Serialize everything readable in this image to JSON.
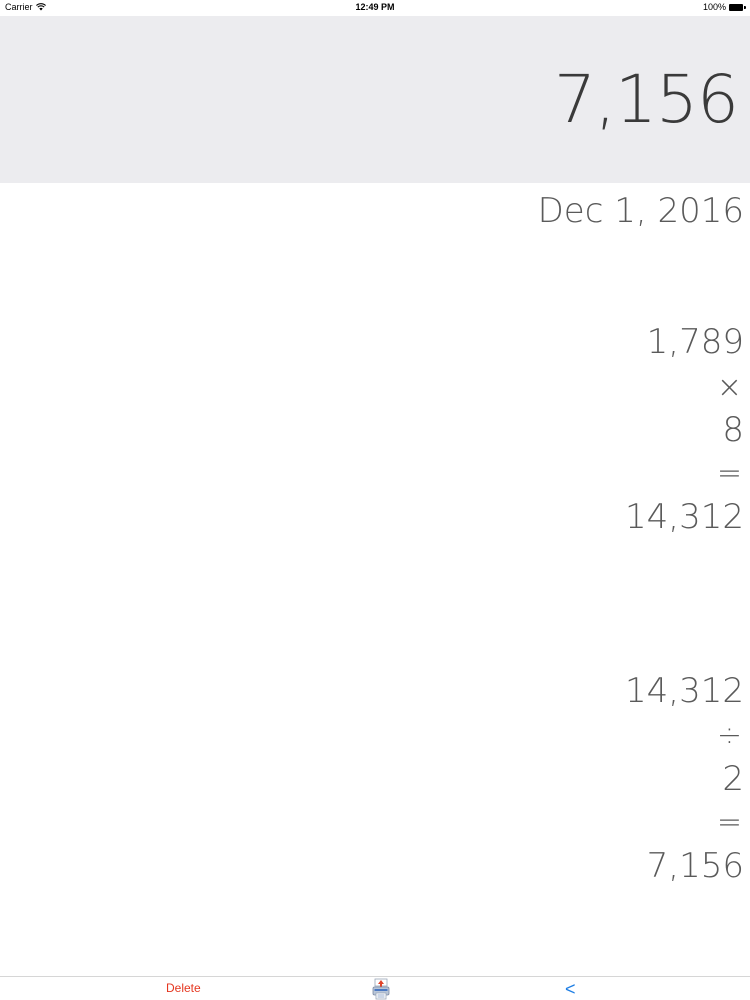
{
  "status_bar": {
    "carrier": "Carrier",
    "time": "12:49 PM",
    "battery": "100%"
  },
  "display": {
    "value": "7,156"
  },
  "tape": {
    "date": "Dec 1, 2016",
    "calculations": [
      {
        "operand1": "1,789",
        "operator": "×",
        "operand2": "8",
        "equals": "=",
        "result": "14,312"
      },
      {
        "operand1": "14,312",
        "operator": "÷",
        "operand2": "2",
        "equals": "=",
        "result": "7,156"
      }
    ]
  },
  "toolbar": {
    "delete_label": "Delete",
    "print_icon": "printer-icon",
    "back_label": "<"
  },
  "colors": {
    "display_background": "#ececef",
    "delete": "#e5361f",
    "back": "#1e7ee4",
    "text": "#5a5a5a"
  }
}
